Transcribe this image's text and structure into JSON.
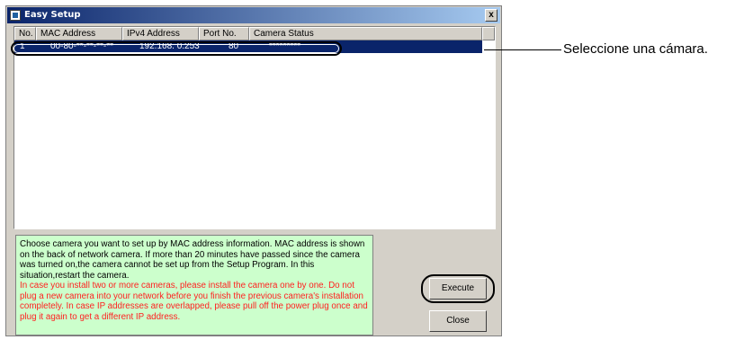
{
  "window": {
    "title": "Easy Setup",
    "close_label": "x"
  },
  "table": {
    "columns": [
      "No.",
      "MAC Address",
      "IPv4 Address",
      "Port No.",
      "Camera Status"
    ],
    "rows": [
      {
        "no": "1",
        "mac": "00-80-**-**-**-**",
        "ip": "192.168.  0.253",
        "port": "80",
        "status": "*********",
        "selected": true
      }
    ]
  },
  "message": {
    "info": "Choose camera you want to set up by MAC address information. MAC address is shown on the back of network camera. If more than 20 minutes have passed since the camera was turned on,the camera cannot be set up from the Setup Program. In this situation,restart the camera.",
    "warning": "In case you install two or more cameras, please install the camera one by one. Do not plug a new camera into your network before you finish the previous camera's installation completely. In case IP addresses are overlapped, please pull off the power plug once and plug it again to get a different IP address."
  },
  "buttons": {
    "execute": "Execute",
    "close": "Close"
  },
  "annotation": {
    "callout": "Seleccione una cámara."
  },
  "colors": {
    "selection": "#0a246a",
    "message_background": "#ccffcc",
    "warning_text": "#ff2020",
    "dialog_face": "#d4d0c8"
  }
}
